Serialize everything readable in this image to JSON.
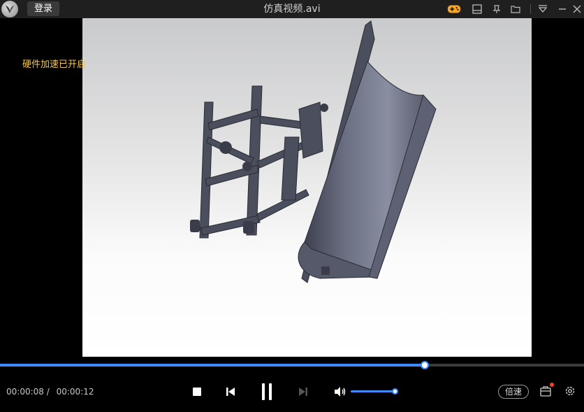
{
  "titlebar": {
    "login_label": "登录",
    "title": "仿真视频.avi",
    "icons": [
      "app-logo-icon",
      "game-icon",
      "mini-mode-icon",
      "pin-icon",
      "folder-icon",
      "menu-icon",
      "minimize-icon",
      "close-icon"
    ],
    "game_icon_color": "#f5a623"
  },
  "overlay": {
    "hw_accel": "硬件加速已开启"
  },
  "playback": {
    "current_time": "00:00:08",
    "separator": "/",
    "total_time": "00:00:12",
    "progress_fraction": 0.727,
    "volume_fraction": 1.0,
    "accent_color": "#3d8bff"
  },
  "controls": {
    "speed_label": "倍速"
  }
}
